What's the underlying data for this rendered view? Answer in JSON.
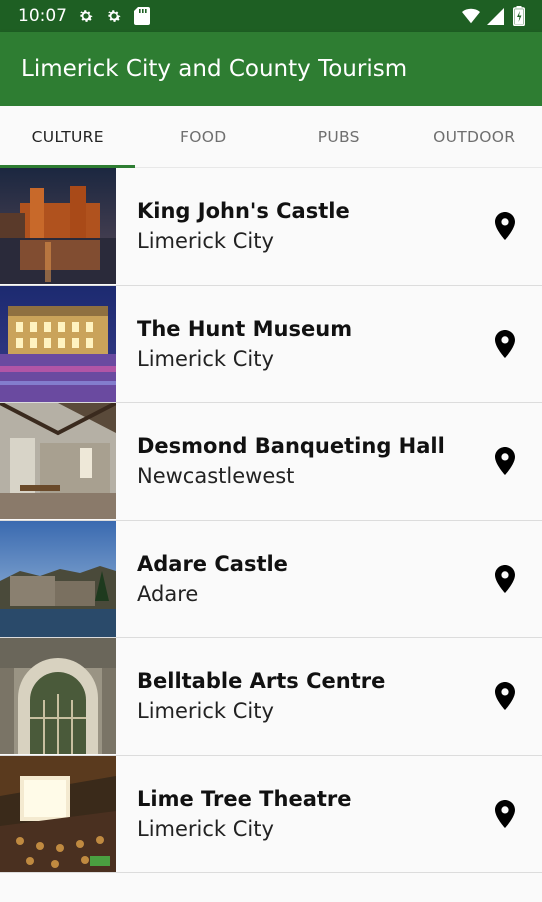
{
  "status_bar": {
    "time": "10:07"
  },
  "app_bar": {
    "title": "Limerick City and County Tourism"
  },
  "tabs": [
    {
      "label": "CULTURE",
      "active": true
    },
    {
      "label": "FOOD",
      "active": false
    },
    {
      "label": "PUBS",
      "active": false
    },
    {
      "label": "OUTDOOR",
      "active": false
    }
  ],
  "items": [
    {
      "title": "King John's Castle",
      "location": "Limerick City",
      "icon": "map-pin-icon"
    },
    {
      "title": "The Hunt Museum",
      "location": "Limerick City",
      "icon": "map-pin-icon"
    },
    {
      "title": "Desmond Banqueting Hall",
      "location": "Newcastlewest",
      "icon": "map-pin-icon"
    },
    {
      "title": "Adare Castle",
      "location": "Adare",
      "icon": "map-pin-icon"
    },
    {
      "title": "Belltable Arts Centre",
      "location": "Limerick City",
      "icon": "map-pin-icon"
    },
    {
      "title": "Lime Tree Theatre",
      "location": "Limerick City",
      "icon": "map-pin-icon"
    }
  ],
  "colors": {
    "status_bar": "#1e5f23",
    "app_bar": "#2e7d32",
    "tab_indicator": "#2e7d32"
  }
}
